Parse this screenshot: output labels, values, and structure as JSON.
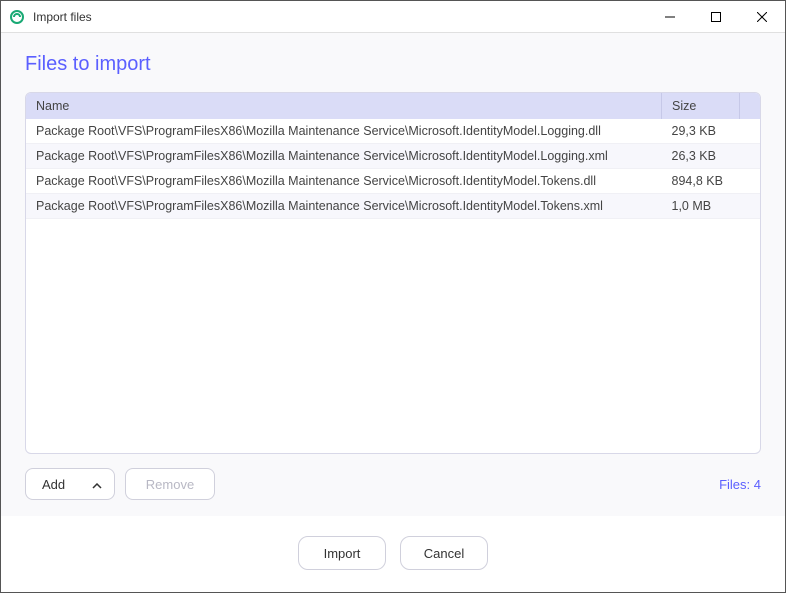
{
  "window": {
    "title": "Import files"
  },
  "page": {
    "heading": "Files to import"
  },
  "table": {
    "columns": {
      "name": "Name",
      "size": "Size"
    },
    "rows": [
      {
        "name": "Package Root\\VFS\\ProgramFilesX86\\Mozilla Maintenance Service\\Microsoft.IdentityModel.Logging.dll",
        "size": "29,3 KB"
      },
      {
        "name": "Package Root\\VFS\\ProgramFilesX86\\Mozilla Maintenance Service\\Microsoft.IdentityModel.Logging.xml",
        "size": "26,3 KB"
      },
      {
        "name": "Package Root\\VFS\\ProgramFilesX86\\Mozilla Maintenance Service\\Microsoft.IdentityModel.Tokens.dll",
        "size": "894,8 KB"
      },
      {
        "name": "Package Root\\VFS\\ProgramFilesX86\\Mozilla Maintenance Service\\Microsoft.IdentityModel.Tokens.xml",
        "size": "1,0 MB"
      }
    ]
  },
  "toolbar": {
    "add_label": "Add",
    "remove_label": "Remove",
    "file_count_label": "Files: 4"
  },
  "footer": {
    "import_label": "Import",
    "cancel_label": "Cancel"
  }
}
